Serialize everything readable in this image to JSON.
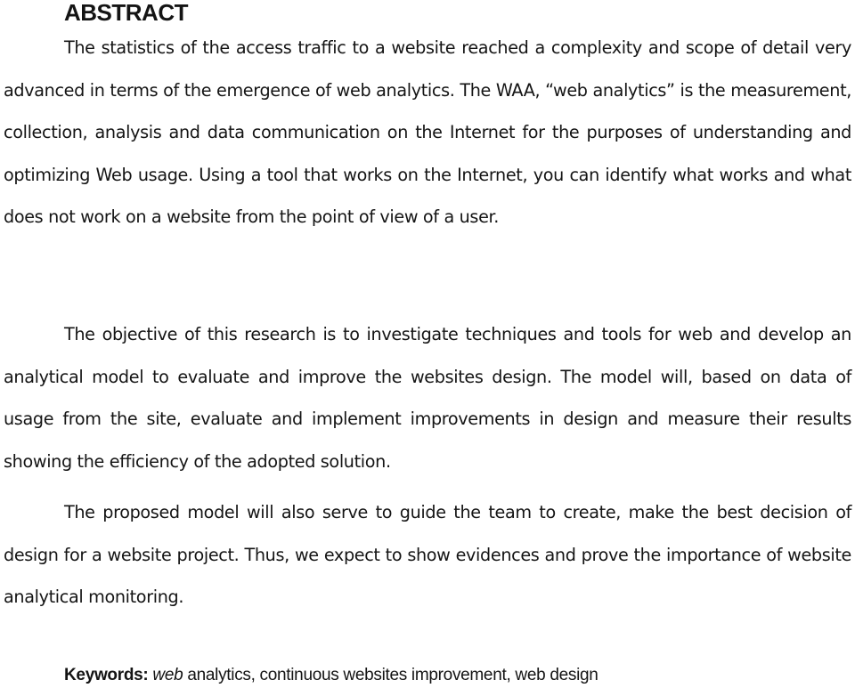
{
  "document": {
    "heading": "ABSTRACT",
    "paragraphs": [
      "The statistics of the access traffic to a website reached a complexity and scope of detail very advanced in terms of the emergence of web analytics. The WAA, “web analytics” is the measurement, collection, analysis and data communication on the Internet for the purposes of understanding and optimizing Web usage. Using a tool that works on the Internet, you can identify what works and what does not work on a website from the point of view of a user.",
      "The objective of this research is to investigate techniques and tools for web and develop an analytical model to evaluate and improve the websites design. The model will, based on data of usage from the site, evaluate and implement improvements in design and measure their results showing the efficiency of the adopted solution.",
      "The proposed model will also serve to guide the team to create, make the best decision of design for a website project. Thus, we expect to show evidences and prove the importance of website analytical monitoring."
    ],
    "keywords": {
      "label": "Keywords:",
      "italic_term": "web",
      "rest": " analytics, continuous websites improvement, web design"
    }
  }
}
